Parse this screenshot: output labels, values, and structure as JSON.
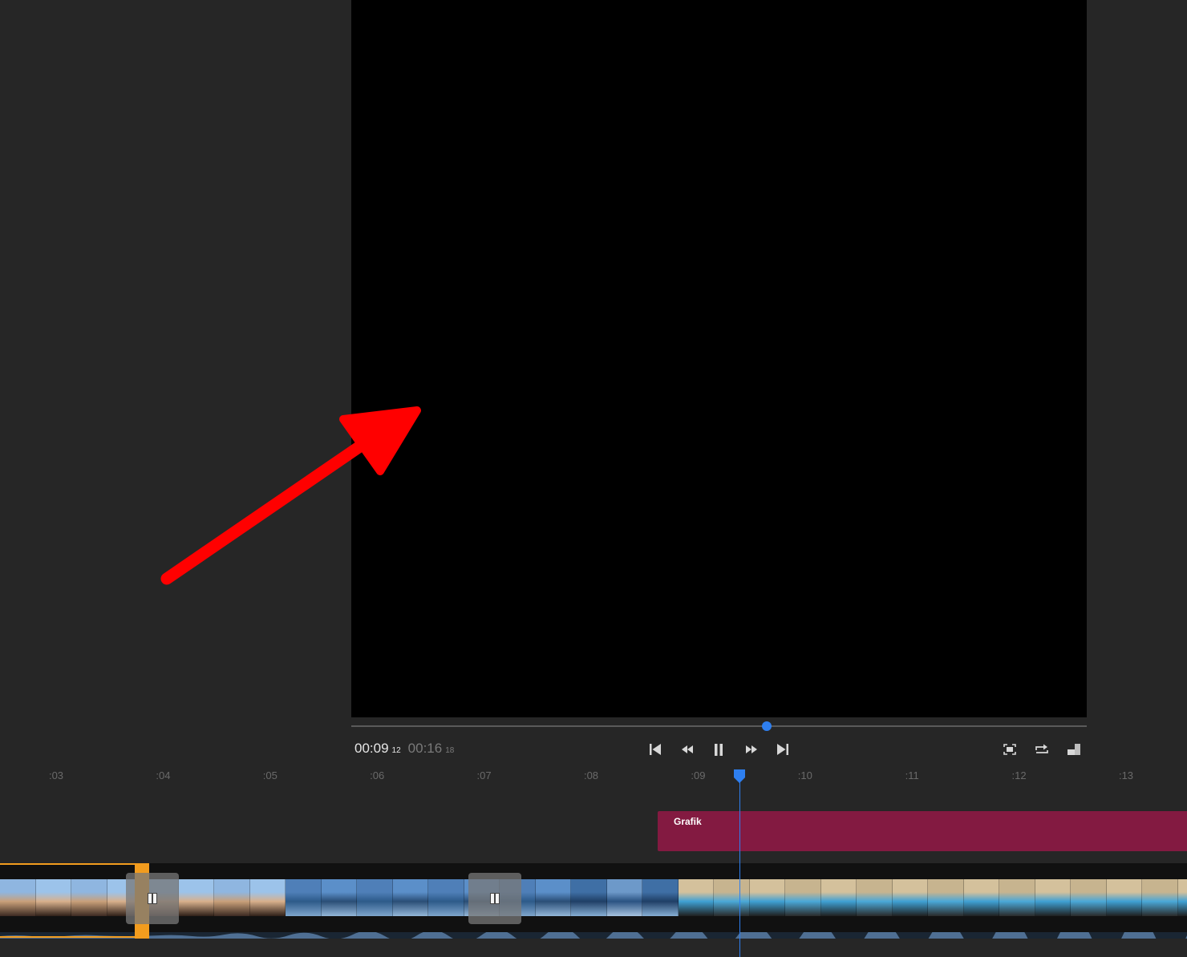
{
  "player": {
    "current_time": "00:09",
    "current_frames": "12",
    "total_time": "00:16",
    "total_frames": "18",
    "progress": 0.565,
    "controls": [
      "skip-to-start-icon",
      "rewind-icon",
      "pause-icon",
      "fast-forward-icon",
      "skip-to-end-icon"
    ],
    "tools": [
      "fit-to-frame-icon",
      "loop-icon",
      "resize-icon"
    ]
  },
  "timeline": {
    "ticks": [
      ":03",
      ":04",
      ":05",
      ":06",
      ":07",
      ":08",
      ":09",
      ":10",
      ":11",
      ":12",
      ":13"
    ],
    "tick_seconds": [
      3,
      4,
      5,
      6,
      7,
      8,
      9,
      10,
      11,
      12,
      13
    ],
    "playhead_seconds": 9.4,
    "graphic_clip_label": "Grafik"
  },
  "colors": {
    "accent": "#2e7ff0",
    "selection": "#f29c1e",
    "graphic_clip": "#831a41",
    "annotation": "#ff0000"
  }
}
